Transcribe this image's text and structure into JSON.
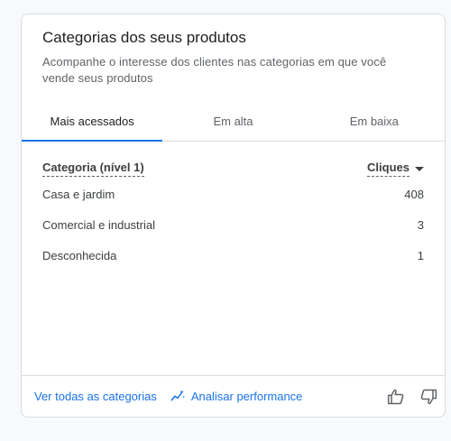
{
  "card": {
    "title": "Categorias dos seus produtos",
    "subtitle": "Acompanhe o interesse dos clientes nas categorias em que você vende seus produtos"
  },
  "tabs": [
    {
      "label": "Mais acessados",
      "active": true
    },
    {
      "label": "Em alta",
      "active": false
    },
    {
      "label": "Em baixa",
      "active": false
    }
  ],
  "table": {
    "col_category": "Categoria (nível 1)",
    "col_metric": "Cliques",
    "rows": [
      {
        "category": "Casa e jardim",
        "value": "408"
      },
      {
        "category": "Comercial e industrial",
        "value": "3"
      },
      {
        "category": "Desconhecida",
        "value": "1"
      }
    ]
  },
  "footer": {
    "view_all": "Ver todas as categorias",
    "analyze": "Analisar performance",
    "icons": [
      "sparkline-icon",
      "thumbs-up-icon",
      "thumbs-down-icon"
    ]
  },
  "colors": {
    "accent": "#1a73e8",
    "border": "#dadce0",
    "text": "#3c4043"
  }
}
